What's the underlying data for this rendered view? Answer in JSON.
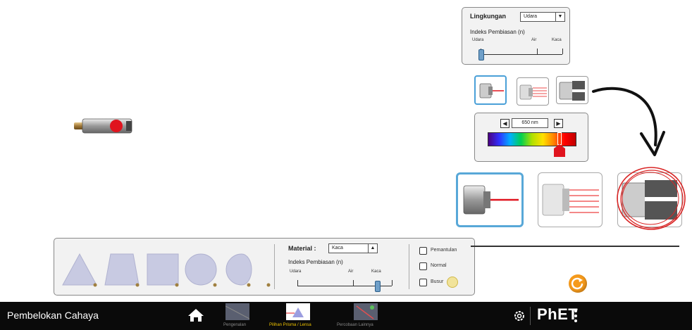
{
  "environment": {
    "label": "Lingkungan",
    "selected": "Udara",
    "index_label": "Indeks Pembiasan (n)",
    "ticks": [
      "Udara",
      "Air",
      "Kaca"
    ]
  },
  "wavelength": {
    "value": "650 nm"
  },
  "material": {
    "label": "Material :",
    "selected": "Kaca",
    "index_label": "Indeks Pembiasan (n)",
    "ticks": [
      "Udara",
      "Air",
      "Kaca"
    ]
  },
  "checkboxes": {
    "reflections": "Pemantulan",
    "normal": "Normal",
    "protractor": "Busur"
  },
  "navbar": {
    "title": "Pembelokan Cahaya",
    "screens": [
      {
        "label": "Pengenalan"
      },
      {
        "label": "Pilihan Prisma / Lensa"
      },
      {
        "label": "Percobaan Lainnya"
      }
    ],
    "brand": "PhET"
  },
  "colors": {
    "accent_blue": "#58a8d8",
    "laser_red": "#e0141e",
    "active_screen_label": "#f0c400",
    "reset_orange": "#f59a1c",
    "annotation_circle": "#d92626"
  },
  "icons": [
    "laser-pointer-icon",
    "home-icon",
    "gear-icon",
    "reset-icon",
    "menu-icon",
    "curved-arrow-icon"
  ]
}
